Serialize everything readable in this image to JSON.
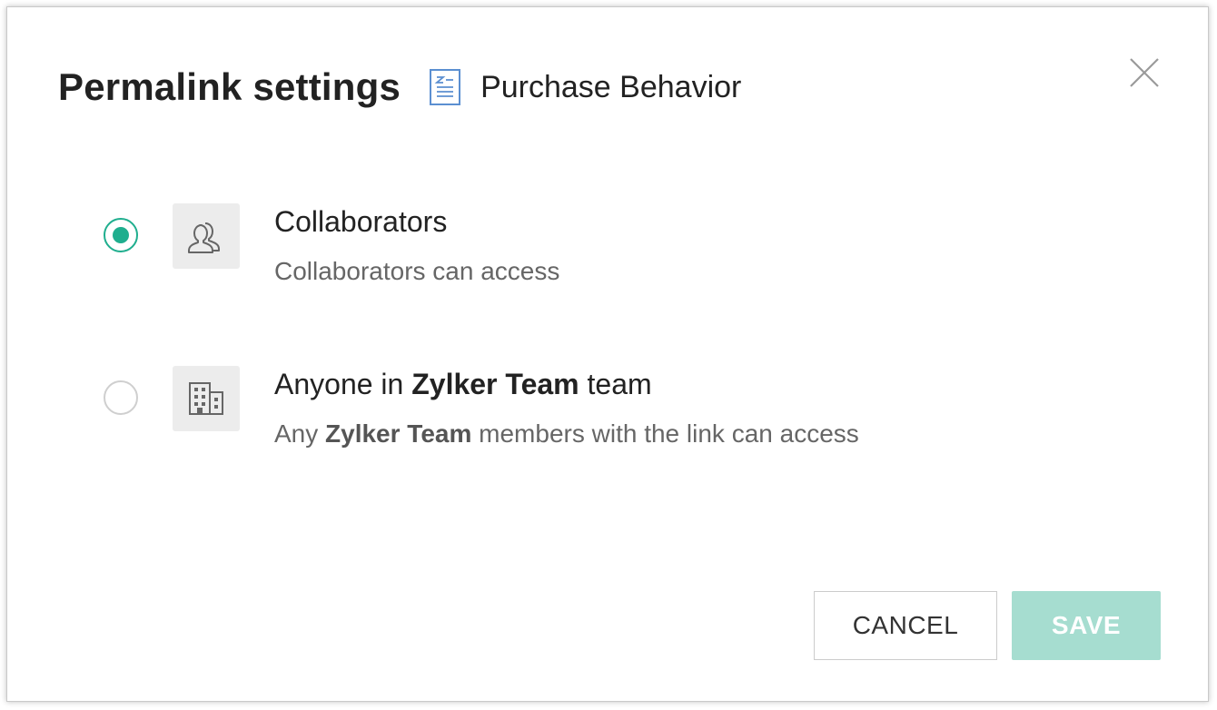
{
  "dialog": {
    "title": "Permalink settings",
    "document_icon": "document-icon",
    "document_name": "Purchase Behavior",
    "close_icon": "close-icon"
  },
  "options": [
    {
      "icon": "users-icon",
      "selected": true,
      "title": "Collaborators",
      "description": "Collaborators can access"
    },
    {
      "icon": "building-icon",
      "selected": false,
      "title_prefix": "Anyone in ",
      "title_bold": "Zylker Team",
      "title_suffix": " team",
      "desc_prefix": "Any ",
      "desc_bold": "Zylker Team",
      "desc_suffix": " members with the link can access"
    }
  ],
  "buttons": {
    "cancel_label": "CANCEL",
    "save_label": "SAVE"
  },
  "colors": {
    "accent": "#1fae8e",
    "save_disabled": "#a6ddd0"
  }
}
